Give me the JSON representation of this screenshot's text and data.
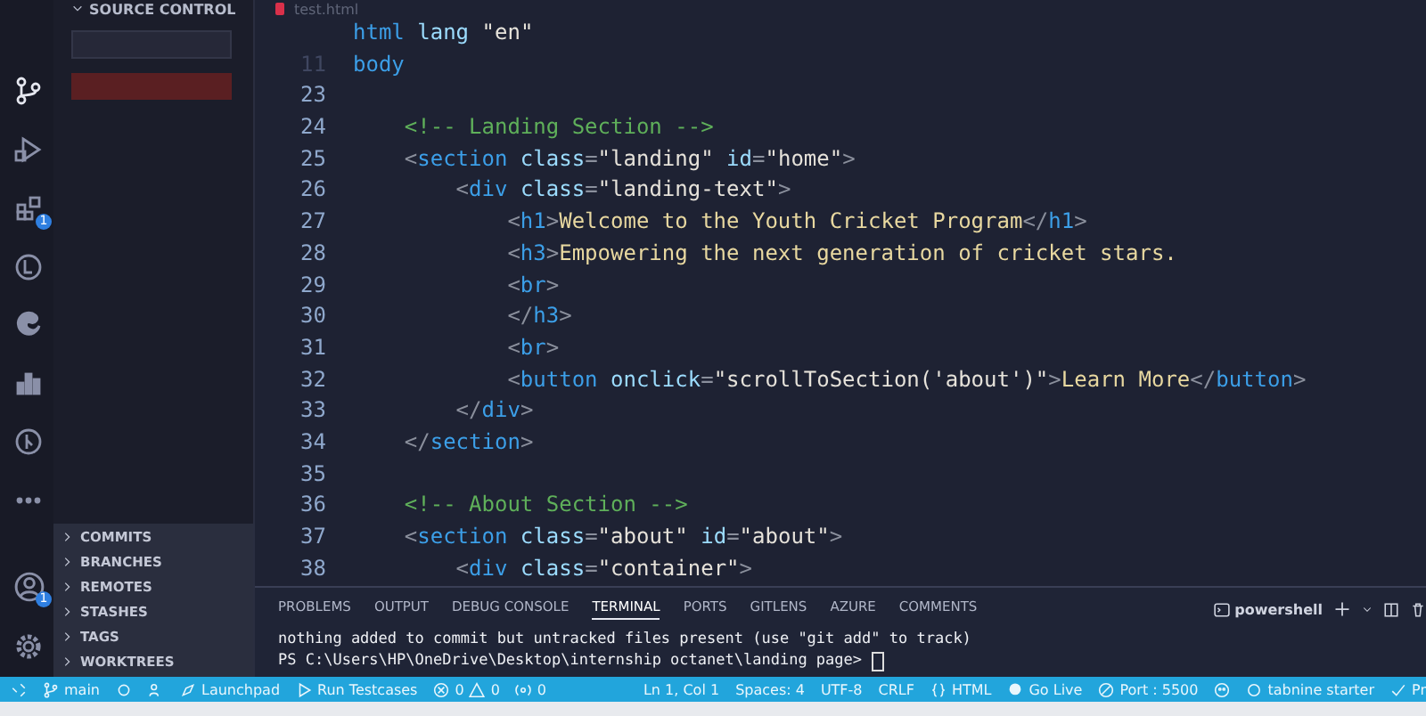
{
  "activity_bar": [
    {
      "selected": true
    },
    {
      "selected": false
    },
    {
      "selected": false,
      "badge": "1"
    },
    {
      "selected": false
    },
    {
      "selected": false
    },
    {
      "selected": false
    },
    {
      "selected": false
    },
    {
      "selected": false
    }
  ],
  "accounts_badge": "1",
  "sidebar": {
    "title": "SOURCE CONTROL",
    "sections": [
      {
        "label": "COMMITS",
        "expanded": false
      },
      {
        "label": "BRANCHES",
        "expanded": false
      },
      {
        "label": "REMOTES",
        "expanded": false
      },
      {
        "label": "STASHES",
        "expanded": false
      },
      {
        "label": "TAGS",
        "expanded": false
      },
      {
        "label": "WORKTREES",
        "expanded": false
      }
    ]
  },
  "editor": {
    "tab": "test.html",
    "sticky": [
      {
        "tokens": [
          {
            "kind": "t",
            "text": "html"
          },
          {
            "kind": "a",
            "text": " lang "
          },
          {
            "kind": "s",
            "text": "\"en\""
          }
        ]
      },
      {
        "num": "11",
        "tokens": [
          {
            "kind": "t",
            "text": "body"
          }
        ]
      }
    ],
    "lines": [
      {
        "num": "23"
      },
      {
        "num": "24",
        "tokens": [
          {
            "kind": "c",
            "text": "    <!-- Landing Section -->"
          }
        ]
      },
      {
        "num": "25",
        "tokens": [
          {
            "kind": "p",
            "text": "    <"
          },
          {
            "kind": "t",
            "text": "section"
          },
          {
            "kind": "a",
            "text": " class"
          },
          {
            "kind": "p",
            "text": "="
          },
          {
            "kind": "s",
            "text": "\"landing\""
          },
          {
            "kind": "a",
            "text": " id"
          },
          {
            "kind": "p",
            "text": "="
          },
          {
            "kind": "s",
            "text": "\"home\""
          },
          {
            "kind": "p",
            "text": ">"
          }
        ]
      },
      {
        "num": "26",
        "tokens": [
          {
            "kind": "p",
            "text": "        <"
          },
          {
            "kind": "t",
            "text": "div"
          },
          {
            "kind": "a",
            "text": " class"
          },
          {
            "kind": "p",
            "text": "="
          },
          {
            "kind": "s",
            "text": "\"landing-text\""
          },
          {
            "kind": "p",
            "text": ">"
          }
        ]
      },
      {
        "num": "27",
        "tokens": [
          {
            "kind": "p",
            "text": "            <"
          },
          {
            "kind": "t",
            "text": "h1"
          },
          {
            "kind": "p",
            "text": ">"
          },
          {
            "kind": "x",
            "text": "Welcome to the Youth Cricket Program"
          },
          {
            "kind": "p",
            "text": "</"
          },
          {
            "kind": "t",
            "text": "h1"
          },
          {
            "kind": "p",
            "text": ">"
          }
        ]
      },
      {
        "num": "28",
        "tokens": [
          {
            "kind": "p",
            "text": "            <"
          },
          {
            "kind": "t",
            "text": "h3"
          },
          {
            "kind": "p",
            "text": ">"
          },
          {
            "kind": "x",
            "text": "Empowering the next generation of cricket stars."
          }
        ]
      },
      {
        "num": "29",
        "tokens": [
          {
            "kind": "p",
            "text": "            <"
          },
          {
            "kind": "t",
            "text": "br"
          },
          {
            "kind": "p",
            "text": ">"
          }
        ]
      },
      {
        "num": "30",
        "tokens": [
          {
            "kind": "p",
            "text": "            </"
          },
          {
            "kind": "t",
            "text": "h3"
          },
          {
            "kind": "p",
            "text": ">"
          }
        ]
      },
      {
        "num": "31",
        "tokens": [
          {
            "kind": "p",
            "text": "            <"
          },
          {
            "kind": "t",
            "text": "br"
          },
          {
            "kind": "p",
            "text": ">"
          }
        ]
      },
      {
        "num": "32",
        "tokens": [
          {
            "kind": "p",
            "text": "            <"
          },
          {
            "kind": "t",
            "text": "button"
          },
          {
            "kind": "a",
            "text": " onclick"
          },
          {
            "kind": "p",
            "text": "="
          },
          {
            "kind": "s",
            "text": "\"scrollToSection('about')\""
          },
          {
            "kind": "p",
            "text": ">"
          },
          {
            "kind": "x",
            "text": "Learn More"
          },
          {
            "kind": "p",
            "text": "</"
          },
          {
            "kind": "t",
            "text": "button"
          },
          {
            "kind": "p",
            "text": ">"
          }
        ]
      },
      {
        "num": "33",
        "tokens": [
          {
            "kind": "p",
            "text": "        </"
          },
          {
            "kind": "t",
            "text": "div"
          },
          {
            "kind": "p",
            "text": ">"
          }
        ]
      },
      {
        "num": "34",
        "tokens": [
          {
            "kind": "p",
            "text": "    </"
          },
          {
            "kind": "t",
            "text": "section"
          },
          {
            "kind": "p",
            "text": ">"
          }
        ]
      },
      {
        "num": "35"
      },
      {
        "num": "36",
        "tokens": [
          {
            "kind": "c",
            "text": "    <!-- About Section -->"
          }
        ]
      },
      {
        "num": "37",
        "tokens": [
          {
            "kind": "p",
            "text": "    <"
          },
          {
            "kind": "t",
            "text": "section"
          },
          {
            "kind": "a",
            "text": " class"
          },
          {
            "kind": "p",
            "text": "="
          },
          {
            "kind": "s",
            "text": "\"about\""
          },
          {
            "kind": "a",
            "text": " id"
          },
          {
            "kind": "p",
            "text": "="
          },
          {
            "kind": "s",
            "text": "\"about\""
          },
          {
            "kind": "p",
            "text": ">"
          }
        ]
      },
      {
        "num": "38",
        "tokens": [
          {
            "kind": "p",
            "text": "        <"
          },
          {
            "kind": "t",
            "text": "div"
          },
          {
            "kind": "a",
            "text": " class"
          },
          {
            "kind": "p",
            "text": "="
          },
          {
            "kind": "s",
            "text": "\"container\""
          },
          {
            "kind": "p",
            "text": ">"
          }
        ]
      }
    ]
  },
  "panel": {
    "tabs": [
      {
        "label": "PROBLEMS",
        "selected": false
      },
      {
        "label": "OUTPUT",
        "selected": false
      },
      {
        "label": "DEBUG CONSOLE",
        "selected": false
      },
      {
        "label": "TERMINAL",
        "selected": true
      },
      {
        "label": "PORTS",
        "selected": false
      },
      {
        "label": "GITLENS",
        "selected": false
      },
      {
        "label": "AZURE",
        "selected": false
      },
      {
        "label": "COMMENTS",
        "selected": false
      }
    ],
    "shell": "powershell",
    "terminal": [
      "nothing added to commit but untracked files present (use \"git add\" to track)",
      "PS C:\\Users\\HP\\OneDrive\\Desktop\\internship octanet\\landing page> "
    ]
  },
  "status_bar": {
    "branch": "main",
    "launchpad": "Launchpad",
    "run": "Run Testcases",
    "errors": "0",
    "warnings": "0",
    "ports": "0",
    "position": "Ln 1, Col 1",
    "spaces": "Spaces: 4",
    "encoding": "UTF-8",
    "eol": "CRLF",
    "language": "HTML",
    "go_live": "Go Live",
    "port": "Port : 5500",
    "tabnine": "tabnine starter",
    "cut": "Pr"
  }
}
